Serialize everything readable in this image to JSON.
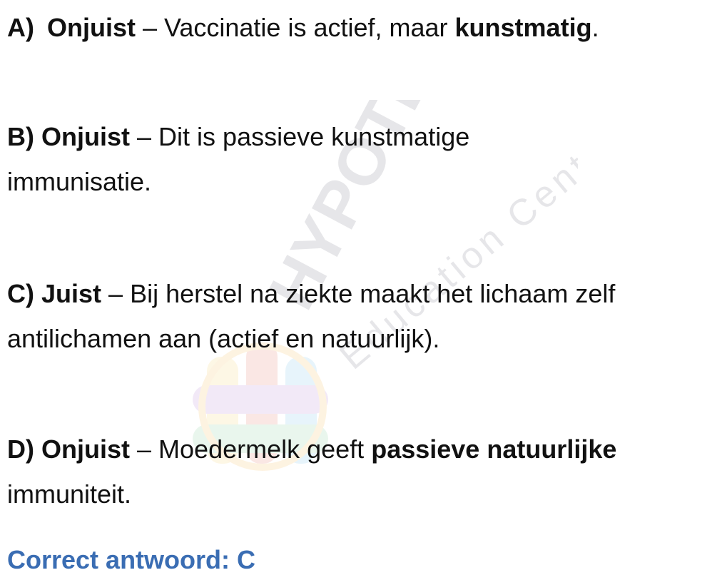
{
  "watermark": {
    "brand": "HYPOTENUSE",
    "tagline": "Education Center"
  },
  "options": [
    {
      "letter": "A)",
      "verdict": "Onjuist",
      "dash": " – ",
      "text_before": "Vaccinatie is actief, maar ",
      "text_bold": "kunstmatig",
      "text_after": "."
    },
    {
      "letter": "B)",
      "verdict": "Onjuist",
      "dash": " – ",
      "line1": "Dit is passieve kunstmatige",
      "line2": "immunisatie."
    },
    {
      "letter": "C)",
      "verdict": "Juist",
      "dash": " – ",
      "line1": "Bij herstel na ziekte maakt het lichaam zelf",
      "line2": "antilichamen aan (actief en natuurlijk)."
    },
    {
      "letter": "D)",
      "verdict": "Onjuist",
      "dash": " – ",
      "text_before": "Moedermelk geeft ",
      "text_bold": "passieve natuurlijke",
      "line2": "immuniteit."
    }
  ],
  "answer": "Correct antwoord: C",
  "colors": {
    "text": "#111111",
    "answer": "#3a6db3"
  }
}
